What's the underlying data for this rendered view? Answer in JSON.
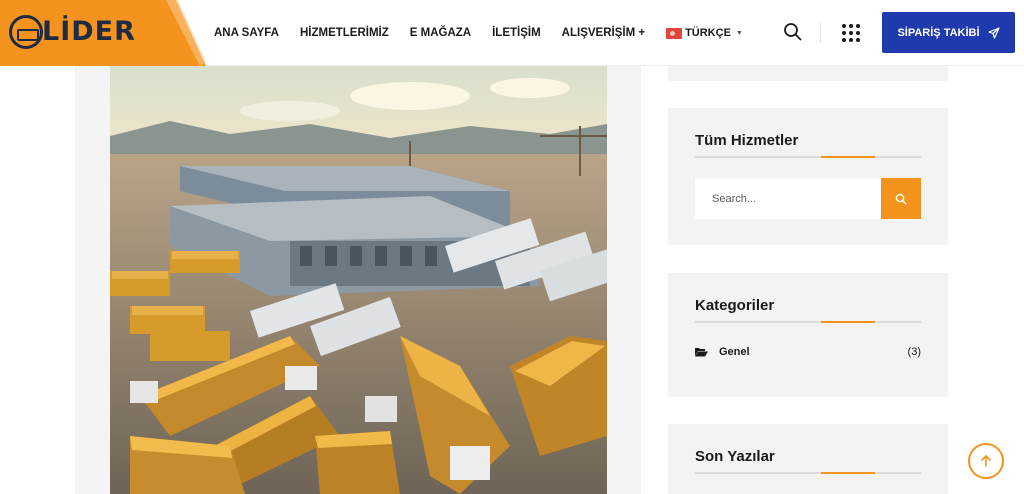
{
  "brand": {
    "name": "LİDER",
    "accent": "#f4941e",
    "primary": "#1f3aac"
  },
  "nav": {
    "items": [
      "ANA SAYFA",
      "HİZMETLERİMİZ",
      "E MAĞAZA",
      "İLETİŞİM",
      "ALIŞVERİŞİM +"
    ],
    "language": "TÜRKÇE"
  },
  "header": {
    "track_button": "SİPARİŞ TAKİBİ"
  },
  "sidebar": {
    "services": {
      "title": "Tüm Hizmetler",
      "search_placeholder": "Search..."
    },
    "categories": {
      "title": "Kategoriler",
      "items": [
        {
          "name": "Genel",
          "count": "(3)"
        }
      ]
    },
    "recent_posts": {
      "title": "Son Yazılar"
    }
  },
  "icons": {
    "header_search": "search-icon",
    "menu": "grid-menu-icon",
    "track": "send-icon",
    "category": "folder-open-icon",
    "scroll_top": "arrow-up-icon"
  }
}
